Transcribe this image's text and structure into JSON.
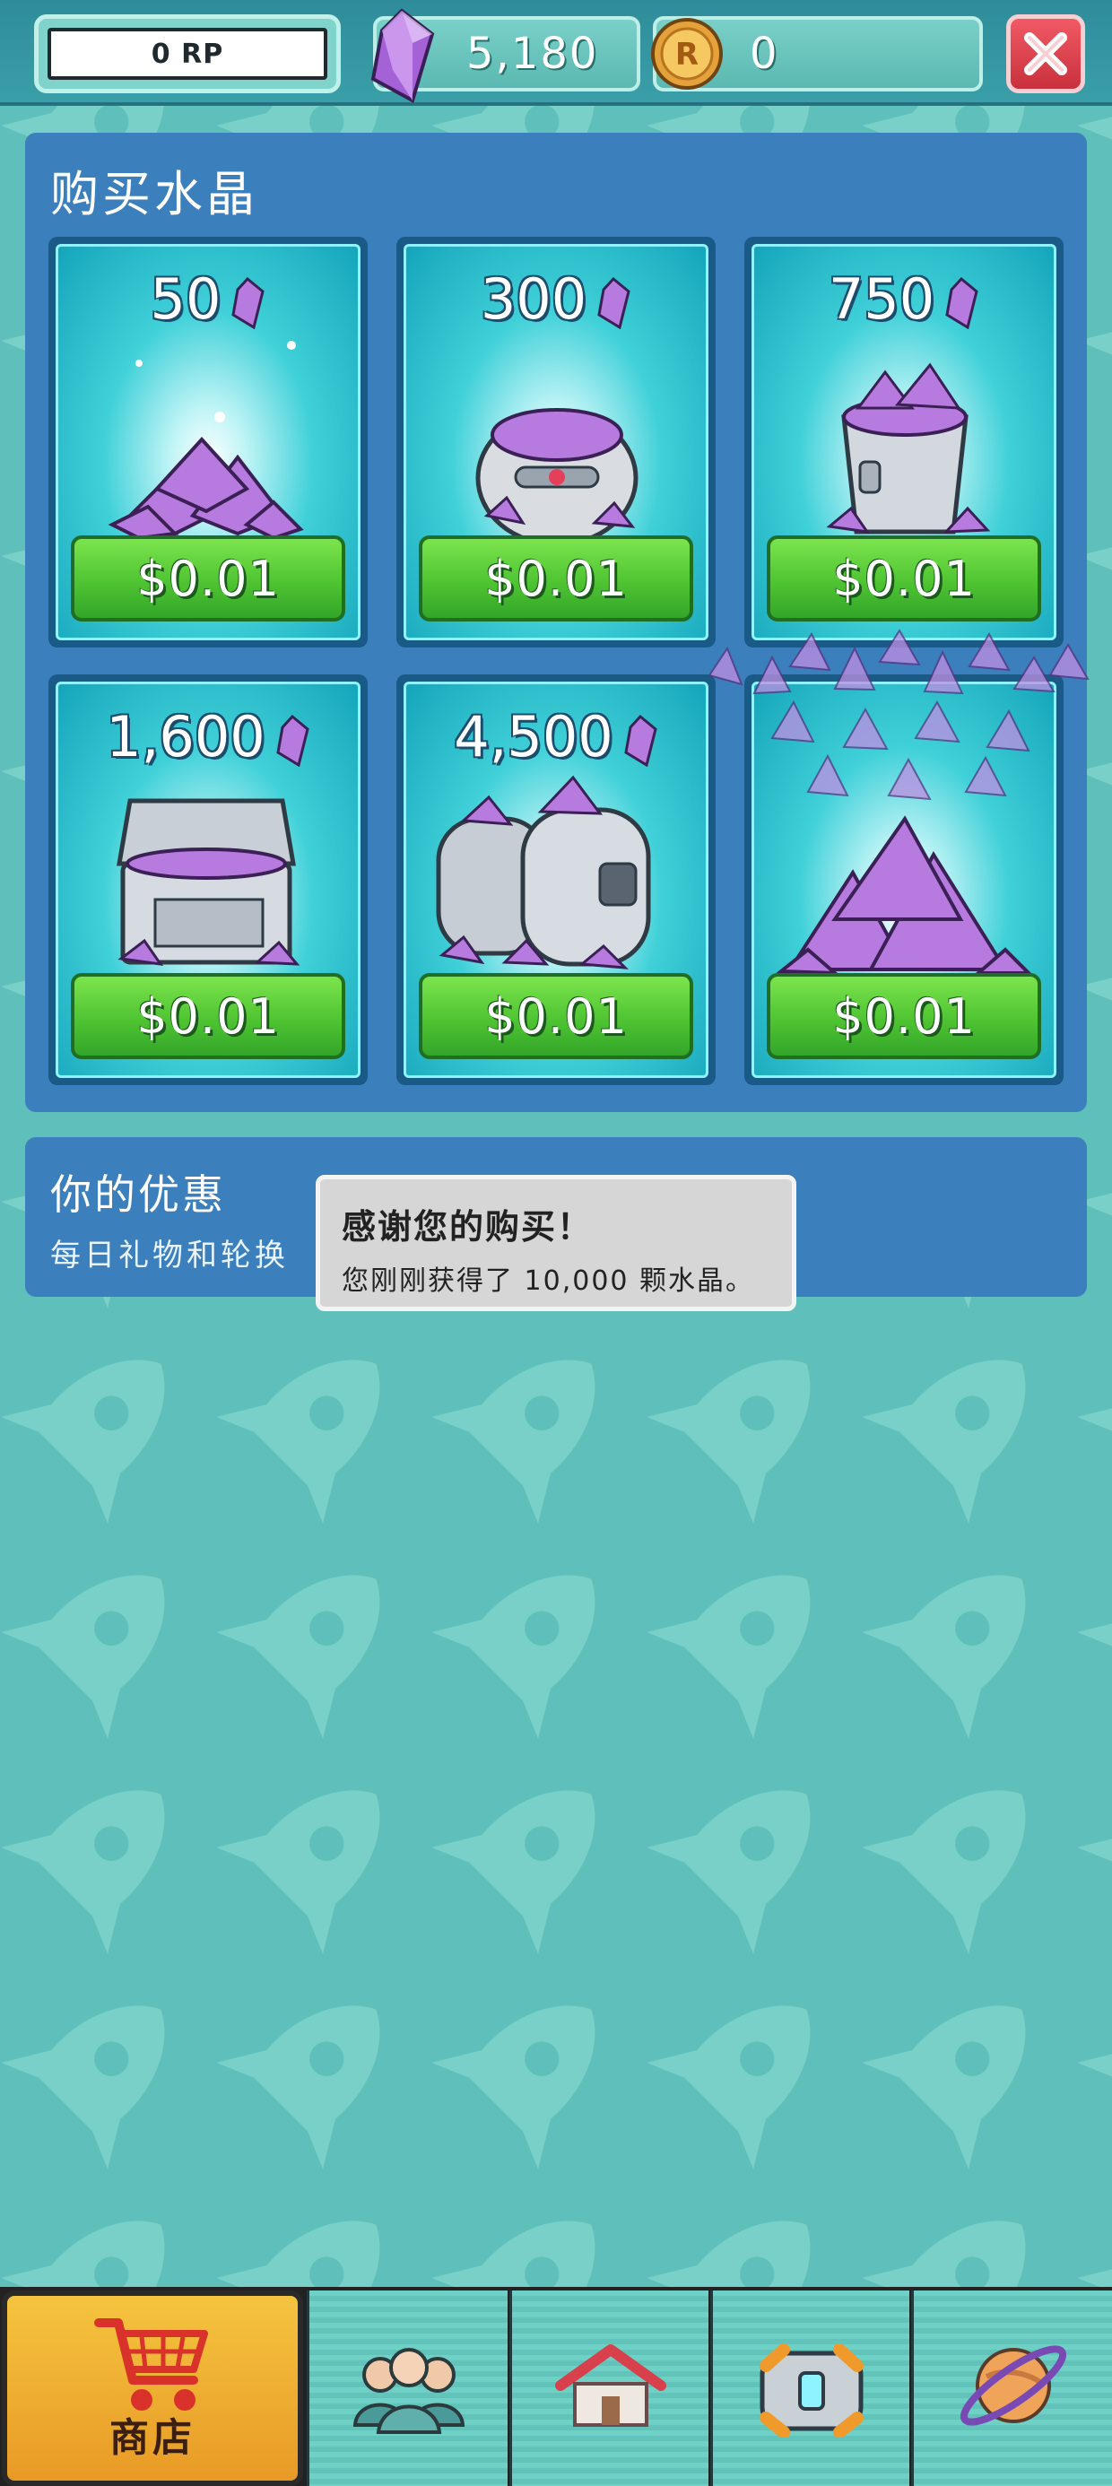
{
  "header": {
    "rp_label": "0 RP",
    "crystals": "5,180",
    "coins": "0",
    "close_icon": "close-icon"
  },
  "shop": {
    "title": "购买水晶",
    "items": [
      {
        "amount": "50",
        "price": "$0.01",
        "art": "crystal-pile"
      },
      {
        "amount": "300",
        "price": "$0.01",
        "art": "crystal-pod"
      },
      {
        "amount": "750",
        "price": "$0.01",
        "art": "crystal-bucket"
      },
      {
        "amount": "1,600",
        "price": "$0.01",
        "art": "crystal-chest"
      },
      {
        "amount": "4,500",
        "price": "$0.01",
        "art": "crystal-barrels"
      },
      {
        "price": "$0.01",
        "art": "crystal-mountain"
      }
    ]
  },
  "offers": {
    "title": "你的优惠",
    "subtitle": "每日礼物和轮换"
  },
  "toast": {
    "title": "感谢您的购买！",
    "body": "您刚刚获得了 10,000 颗水晶。"
  },
  "nav": {
    "tabs": [
      {
        "label": "商店",
        "icon": "cart-icon",
        "active": true
      },
      {
        "icon": "people-icon"
      },
      {
        "icon": "house-icon"
      },
      {
        "icon": "chest-icon"
      },
      {
        "icon": "planet-icon"
      }
    ]
  },
  "colors": {
    "background": "#5fbfba",
    "panel": "#3b7fbd",
    "price_button": "#4fc432",
    "active_tab": "#f5c43f",
    "close_button": "#d9404c",
    "crystal": "#b77be0"
  }
}
